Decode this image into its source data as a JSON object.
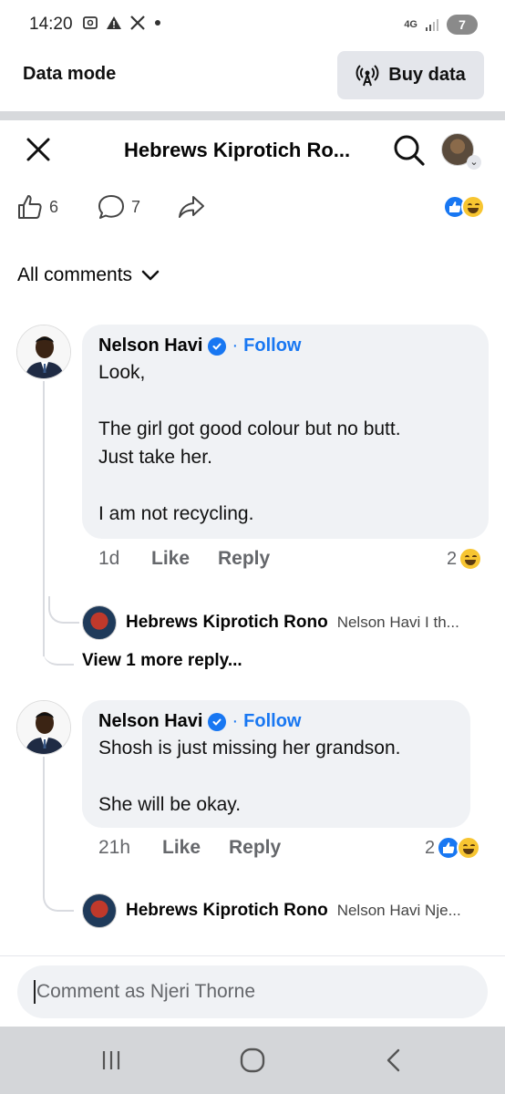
{
  "status_bar": {
    "time": "14:20",
    "network": "4G",
    "battery": "7"
  },
  "data_banner": {
    "mode_label": "Data mode",
    "buy_label": "Buy data"
  },
  "post_header": {
    "title": "Hebrews Kiprotich Ro..."
  },
  "actions": {
    "like_count": "6",
    "comment_count": "7"
  },
  "comments_filter": {
    "label": "All comments"
  },
  "comments": [
    {
      "author": "Nelson Havi",
      "follow_label": "Follow",
      "separator": "·",
      "paragraphs": [
        "Look,",
        "The girl got good colour but no butt.",
        "Just take her.",
        "I am not recycling."
      ],
      "time": "1d",
      "like_label": "Like",
      "reply_label": "Reply",
      "reaction_count": "2",
      "reply_preview": {
        "author": "Hebrews Kiprotich Rono",
        "snippet": "Nelson Havi I th..."
      },
      "view_more": "View 1 more reply..."
    },
    {
      "author": "Nelson Havi",
      "follow_label": "Follow",
      "separator": "·",
      "paragraphs": [
        "Shosh is just missing her grandson.",
        "She will be okay."
      ],
      "time": "21h",
      "like_label": "Like",
      "reply_label": "Reply",
      "reaction_count": "2",
      "reply_preview": {
        "author": "Hebrews Kiprotich Rono",
        "snippet": "Nelson Havi Nje..."
      }
    }
  ],
  "composer": {
    "placeholder": "Comment as Njeri Thorne"
  },
  "colors": {
    "accent": "#1877f2",
    "bubble": "#f0f2f5",
    "haha": "#f7c531"
  }
}
